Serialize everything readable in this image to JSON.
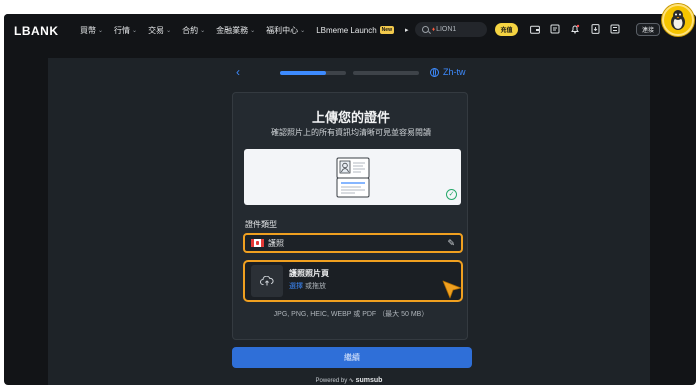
{
  "nav": {
    "logo": "LBANK",
    "items": [
      {
        "label": "買幣",
        "chevron": true
      },
      {
        "label": "行情",
        "chevron": true
      },
      {
        "label": "交易",
        "chevron": true
      },
      {
        "label": "合約",
        "chevron": true
      },
      {
        "label": "金融業務",
        "chevron": true
      },
      {
        "label": "福利中心",
        "chevron": true
      },
      {
        "label": "LBmeme Launch",
        "badge": "New"
      }
    ],
    "search_text": "LION1",
    "deposit": "充值",
    "login": "連接"
  },
  "verify": {
    "lang": "Zh-tw",
    "title": "上傳您的證件",
    "subtitle": "確認照片上的所有資訊均清晰可見並容易閱讀",
    "type_label": "證件類型",
    "type_value": "護照",
    "upload_title": "護照照片頁",
    "upload_choose": "選擇",
    "upload_or_drag": " 或拖放",
    "formats": "JPG, PNG, HEIC, WEBP 或 PDF （最大 50 MB）",
    "continue": "繼續",
    "powered_by": "Powered by",
    "powered_brand": "sumsub"
  },
  "colors": {
    "accent": "#3d8bff",
    "highlight": "#f0a020",
    "success": "#27a86b",
    "deposit": "#f5d442"
  }
}
